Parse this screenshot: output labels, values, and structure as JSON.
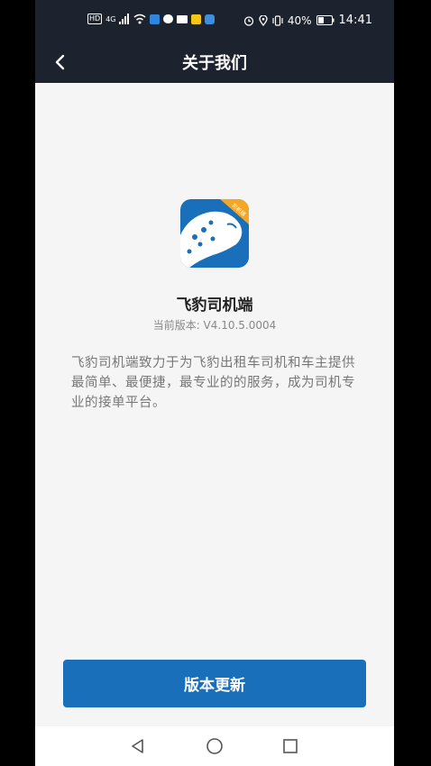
{
  "status_bar": {
    "net_badge": "HD",
    "net_type": "4G",
    "battery_percent": "40%",
    "time": "14:41"
  },
  "header": {
    "title": "关于我们"
  },
  "app": {
    "badge": "司机端",
    "name": "飞豹司机端",
    "version": "当前版本: V4.10.5.0004",
    "description": "飞豹司机端致力于为飞豹出租车司机和车主提供最简单、最便捷，最专业的的服务，成为司机专业的接单平台。"
  },
  "actions": {
    "update_label": "版本更新"
  },
  "colors": {
    "header_bg": "#1d232e",
    "primary": "#1a6fba",
    "badge": "#f5a623",
    "page_bg": "#f5f5f5"
  },
  "icons": [
    "back-arrow-icon",
    "signal-icon",
    "wifi-icon",
    "alarm-icon",
    "location-icon",
    "vibrate-icon",
    "battery-icon",
    "nav-back-icon",
    "nav-home-icon",
    "nav-recents-icon"
  ]
}
